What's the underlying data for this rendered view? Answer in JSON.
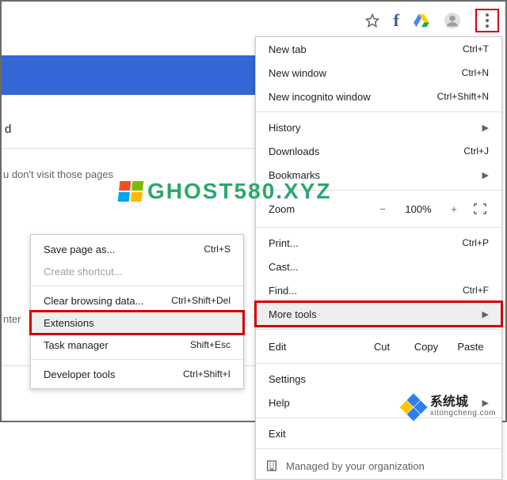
{
  "toolbar_icons": {
    "star": "star-icon",
    "facebook": "f",
    "drive": "drive-icon",
    "profile": "profile-avatar",
    "kebab": "more-icon"
  },
  "background": {
    "d_text": "d",
    "predict_text": "u don't visit those pages",
    "enter_text": "nter"
  },
  "menu": {
    "new_tab": {
      "label": "New tab",
      "shortcut": "Ctrl+T"
    },
    "new_window": {
      "label": "New window",
      "shortcut": "Ctrl+N"
    },
    "new_incognito": {
      "label": "New incognito window",
      "shortcut": "Ctrl+Shift+N"
    },
    "history": {
      "label": "History"
    },
    "downloads": {
      "label": "Downloads",
      "shortcut": "Ctrl+J"
    },
    "bookmarks": {
      "label": "Bookmarks"
    },
    "zoom": {
      "label": "Zoom",
      "minus": "−",
      "value": "100%",
      "plus": "+"
    },
    "print": {
      "label": "Print...",
      "shortcut": "Ctrl+P"
    },
    "cast": {
      "label": "Cast..."
    },
    "find": {
      "label": "Find...",
      "shortcut": "Ctrl+F"
    },
    "more_tools": {
      "label": "More tools"
    },
    "edit": {
      "label": "Edit",
      "cut": "Cut",
      "copy": "Copy",
      "paste": "Paste"
    },
    "settings": {
      "label": "Settings"
    },
    "help": {
      "label": "Help"
    },
    "exit": {
      "label": "Exit"
    },
    "managed": {
      "label": "Managed by your organization"
    }
  },
  "submenu": {
    "save_page": {
      "label": "Save page as...",
      "shortcut": "Ctrl+S"
    },
    "create_shortcut": {
      "label": "Create shortcut..."
    },
    "clear_browsing": {
      "label": "Clear browsing data...",
      "shortcut": "Ctrl+Shift+Del"
    },
    "extensions": {
      "label": "Extensions"
    },
    "task_manager": {
      "label": "Task manager",
      "shortcut": "Shift+Esc"
    },
    "developer_tools": {
      "label": "Developer tools",
      "shortcut": "Ctrl+Shift+I"
    }
  },
  "watermarks": {
    "ghost": "GHOST580.XYZ",
    "xt_cn": "系统城",
    "xt_url": "xitongcheng.com"
  }
}
